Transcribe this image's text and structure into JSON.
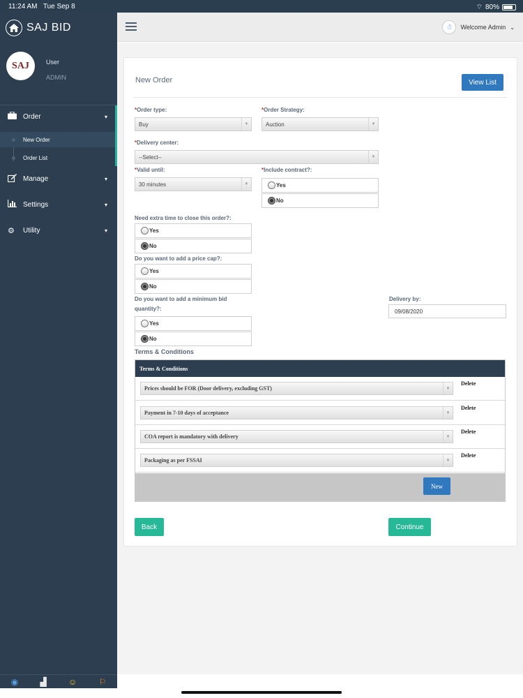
{
  "statusbar": {
    "time": "11:24 AM",
    "date": "Tue Sep 8",
    "battery": "80%"
  },
  "sidebar": {
    "brand": "SAJ BID",
    "logo_text": "SAJ",
    "user_name": "User",
    "user_role": "ADMIN",
    "nav": [
      {
        "label": "Order",
        "icon": "briefcase-icon"
      },
      {
        "label": "Manage",
        "icon": "edit-icon"
      },
      {
        "label": "Settings",
        "icon": "bar-chart-icon"
      },
      {
        "label": "Utility",
        "icon": "gear-icon"
      }
    ],
    "sub_items": [
      {
        "label": "New Order",
        "active": true
      },
      {
        "label": "Order List",
        "active": false
      }
    ],
    "bottom_icons": [
      "eye-icon",
      "toilet-icon",
      "emoji-icon",
      "surfer-icon"
    ]
  },
  "topbar": {
    "welcome": "Welcome Admin"
  },
  "page": {
    "title": "New Order",
    "view_list": "View List",
    "order_type": {
      "label": "Order type:",
      "value": "Buy"
    },
    "order_strategy": {
      "label": "Order Strategy:",
      "value": "Auction"
    },
    "delivery_center": {
      "label": "Delivery center:",
      "value": "--Select--"
    },
    "valid_until": {
      "label": "Valid until:",
      "value": "30 minutes"
    },
    "include_contract": {
      "label": "Include contract?:",
      "yes": "Yes",
      "no": "No",
      "selected": "No"
    },
    "extra_time": {
      "label": "Need extra time to close this order?:",
      "yes": "Yes",
      "no": "No",
      "selected": "No"
    },
    "price_cap": {
      "label": "Do you want to add a price cap?:",
      "yes": "Yes",
      "no": "No",
      "selected": "No"
    },
    "min_bid": {
      "label_line1": "Do you want to add a minimum bid",
      "label_line2": "quantity?:",
      "yes": "Yes",
      "no": "No",
      "selected": "No"
    },
    "delivery_by": {
      "label": "Delivery by:",
      "value": "09/08/2020"
    },
    "terms_label": "Terms & Conditions",
    "terms_header": "Terms & Conditions",
    "terms": [
      {
        "text": "Prices should be FOR (Door delivery, excluding GST)",
        "delete": "Delete"
      },
      {
        "text": "Payment in 7-10 days of acceptance",
        "delete": "Delete"
      },
      {
        "text": "COA report is mandatory with delivery",
        "delete": "Delete"
      },
      {
        "text": "Packaging as per FSSAI",
        "delete": "Delete"
      }
    ],
    "new_button": "New",
    "back_button": "Back",
    "continue_button": "Continue"
  },
  "colors": {
    "sidebar": "#2c3e50",
    "accent": "#26b897",
    "primary": "#3079bf"
  }
}
